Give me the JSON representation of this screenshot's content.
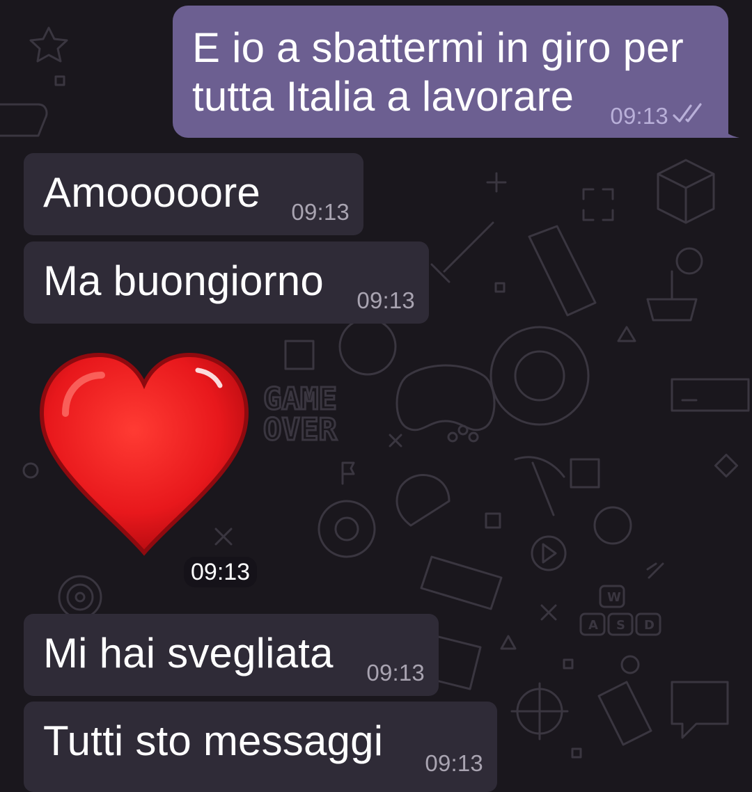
{
  "conversation": {
    "outgoing": {
      "text": "E io a sbattermi in giro per tutta Italia a lavorare",
      "line1": "E io a sbattermi in giro per",
      "line2": "tutta Italia a lavorare",
      "time": "09:13",
      "status_icon": "double-check-read-icon"
    },
    "incoming": [
      {
        "text": "Amooooore",
        "time": "09:13"
      },
      {
        "text": "Ma buongiorno",
        "time": "09:13"
      },
      {
        "text": "Mi hai svegliata",
        "time": "09:13"
      },
      {
        "text": "Tutti sto messaggi",
        "time": "09:13"
      }
    ],
    "sticker": {
      "icon": "red-heart-sticker",
      "time": "09:13"
    }
  },
  "wallpaper": {
    "theme": "gaming-doodles",
    "text_1": "GAME",
    "text_2": "OVER",
    "text_3": "W",
    "text_4": "A",
    "text_5": "S",
    "text_6": "D"
  },
  "colors": {
    "background": "#1a171d",
    "incoming_bubble": "#2f2b37",
    "outgoing_bubble": "#6c5f91",
    "heart": "#e8181c"
  }
}
